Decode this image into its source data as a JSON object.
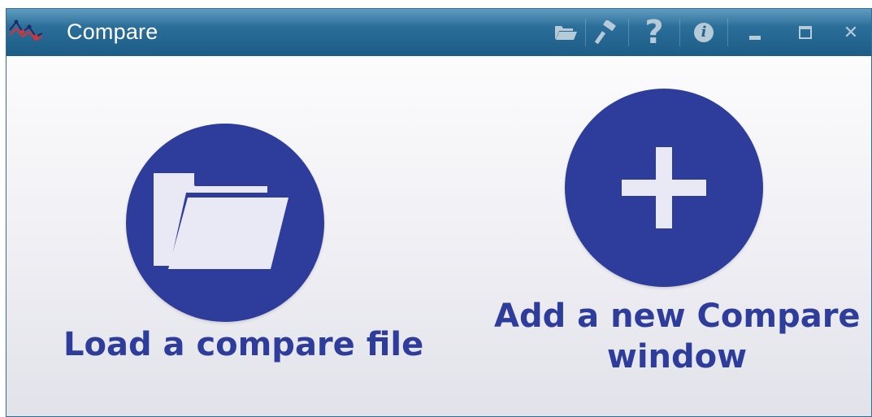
{
  "window": {
    "title": "Compare",
    "title_icon": "app-logo-icon",
    "titlebar_color": "#2b6f9a",
    "accent_color": "#2e3d9c"
  },
  "titlebar_buttons": [
    {
      "name": "open-folder-icon"
    },
    {
      "name": "hammer-icon"
    },
    {
      "name": "help-icon",
      "glyph": "?"
    },
    {
      "name": "info-icon",
      "glyph": "i"
    },
    {
      "name": "minimize-icon"
    },
    {
      "name": "maximize-icon"
    },
    {
      "name": "close-icon",
      "glyph": "✕"
    }
  ],
  "actions": {
    "load": {
      "label": "Load a compare file",
      "icon": "folder-open-icon"
    },
    "add": {
      "label_line1": "Add a new Compare",
      "label_line2": "window",
      "icon": "plus-icon"
    }
  }
}
